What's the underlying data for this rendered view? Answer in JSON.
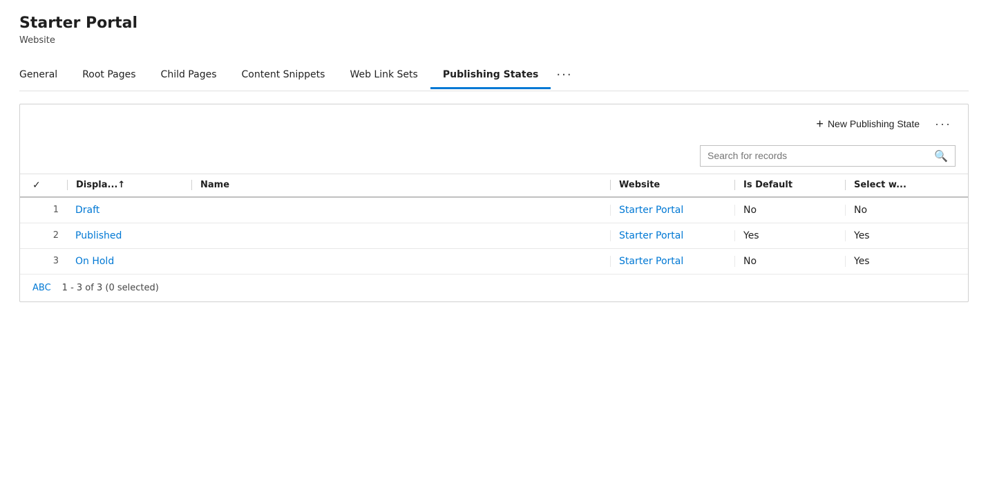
{
  "header": {
    "title": "Starter Portal",
    "subtitle": "Website"
  },
  "tabs": [
    {
      "id": "general",
      "label": "General",
      "active": false
    },
    {
      "id": "root-pages",
      "label": "Root Pages",
      "active": false
    },
    {
      "id": "child-pages",
      "label": "Child Pages",
      "active": false
    },
    {
      "id": "content-snippets",
      "label": "Content Snippets",
      "active": false
    },
    {
      "id": "web-link-sets",
      "label": "Web Link Sets",
      "active": false
    },
    {
      "id": "publishing-states",
      "label": "Publishing States",
      "active": true
    }
  ],
  "toolbar": {
    "new_label": "New Publishing State",
    "more_dots": "···"
  },
  "search": {
    "placeholder": "Search for records"
  },
  "table": {
    "columns": [
      {
        "id": "check",
        "label": "✓"
      },
      {
        "id": "display",
        "label": "Displa...↑"
      },
      {
        "id": "name",
        "label": "Name"
      },
      {
        "id": "website",
        "label": "Website"
      },
      {
        "id": "is_default",
        "label": "Is Default"
      },
      {
        "id": "select_w",
        "label": "Select w..."
      }
    ],
    "rows": [
      {
        "num": 1,
        "name": "Draft",
        "website": "Starter Portal",
        "is_default": "No",
        "select_w": "No"
      },
      {
        "num": 2,
        "name": "Published",
        "website": "Starter Portal",
        "is_default": "Yes",
        "select_w": "Yes"
      },
      {
        "num": 3,
        "name": "On Hold",
        "website": "Starter Portal",
        "is_default": "No",
        "select_w": "Yes"
      }
    ]
  },
  "footer": {
    "abc_label": "ABC",
    "count_label": "1 - 3 of 3 (0 selected)"
  },
  "colors": {
    "active_tab_border": "#0078d4",
    "link_color": "#0078d4"
  }
}
